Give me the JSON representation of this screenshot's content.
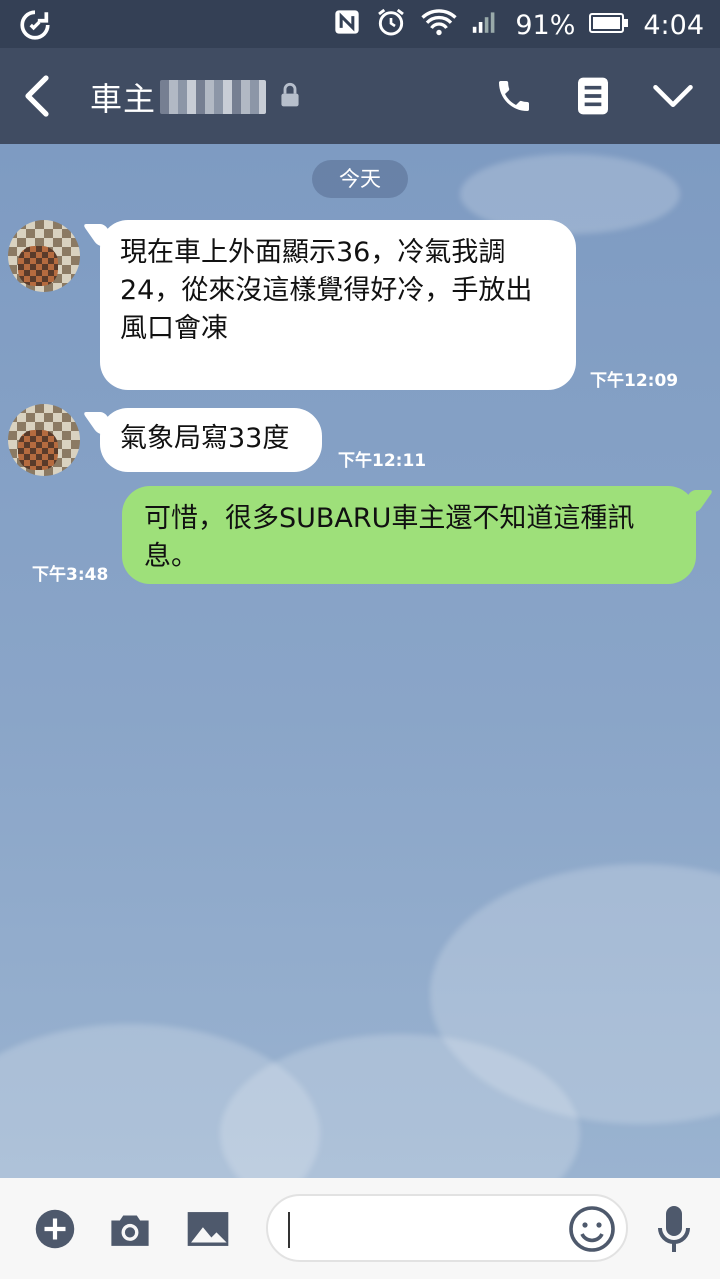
{
  "status_bar": {
    "battery": "91%",
    "time": "4:04"
  },
  "header": {
    "title": "車主",
    "title_obscured_suffix": "redacted"
  },
  "chat": {
    "date_label": "今天",
    "messages": [
      {
        "side": "incoming",
        "text": "現在車上外面顯示36，冷氣我調24，從來沒這樣覺得好冷，手放出風口會凍",
        "time": "下午12:09"
      },
      {
        "side": "incoming",
        "text": "氣象局寫33度",
        "time": "下午12:11"
      },
      {
        "side": "outgoing",
        "text": "可惜，很多SUBARU車主還不知道這種訊息。",
        "time": "下午3:48"
      }
    ]
  },
  "input": {
    "placeholder": ""
  },
  "icons": {
    "status_left": "sync-icon",
    "status_right": [
      "nfc-icon",
      "alarm-icon",
      "wifi-icon",
      "signal-icon",
      "battery-icon"
    ],
    "header_actions": [
      "phone-icon",
      "notes-icon",
      "chevron-down-icon"
    ],
    "input_left": [
      "plus-icon",
      "camera-icon",
      "image-icon"
    ],
    "input_right": [
      "emoji-icon",
      "microphone-icon"
    ]
  },
  "colors": {
    "status_bar": "#344055",
    "app_bar": "#404c62",
    "chat_background": "#7f9cc1",
    "incoming_bubble": "#ffffff",
    "outgoing_bubble": "#9ee07a"
  }
}
